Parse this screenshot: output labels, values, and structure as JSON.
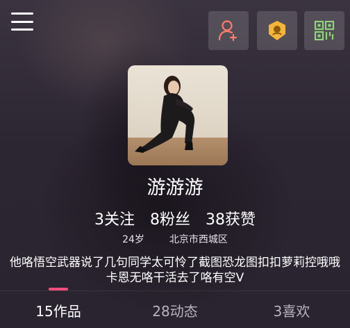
{
  "header": {
    "menu_icon": "hamburger-menu-icon",
    "actions": [
      {
        "icon": "add-friend-icon",
        "color": "#ff7e6b"
      },
      {
        "icon": "badge-icon",
        "color": "#f4b53a"
      },
      {
        "icon": "qr-code-icon",
        "color": "#8fd47a"
      }
    ]
  },
  "profile": {
    "avatar_icon": "avatar",
    "name": "游游游",
    "stats": {
      "following": "3关注",
      "fans": "8粉丝",
      "likes": "38获赞"
    },
    "age": "24岁",
    "location": "北京市西城区",
    "bio": "他咯悟空武器说了几句同学太可怜了截图恐龙图扣扣萝莉控哦哦卡恩无咯干活去了咯有空V"
  },
  "tabs": [
    {
      "label": "15作品",
      "active": true
    },
    {
      "label": "28动态",
      "active": false
    },
    {
      "label": "3喜欢",
      "active": false
    }
  ],
  "colors": {
    "accent": "#ff4d7d",
    "background": "#2a2430"
  }
}
